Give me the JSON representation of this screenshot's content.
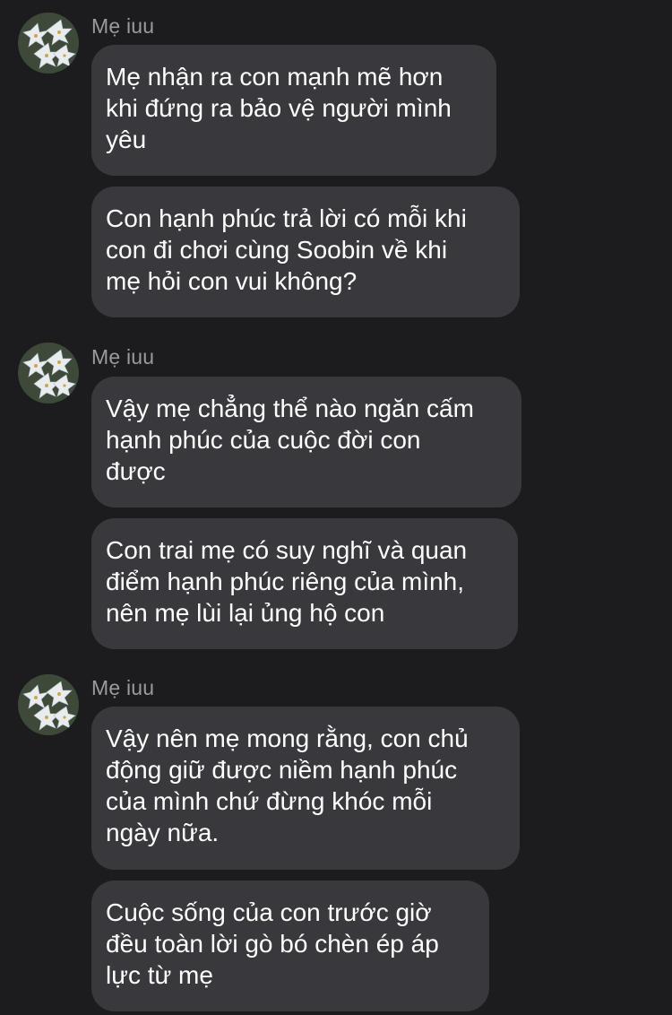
{
  "conversation": {
    "groups": [
      {
        "sender": "Mẹ iuu",
        "messages": [
          "Mẹ nhận ra con mạnh mẽ hơn\nkhi đứng ra bảo vệ người mình\nyêu",
          "Con hạnh phúc trả lời có mỗi khi\ncon đi chơi cùng Soobin về khi\nmẹ hỏi con vui không?"
        ]
      },
      {
        "sender": "Mẹ iuu",
        "messages": [
          "Vậy mẹ chẳng thể nào ngăn cấm\nhạnh phúc của cuộc đời con\nđược",
          "Con trai mẹ có suy nghĩ và quan\nđiểm hạnh phúc riêng của mình,\nnên mẹ lùi lại ủng hộ con"
        ]
      },
      {
        "sender": "Mẹ iuu",
        "messages": [
          "Vậy nên mẹ mong rằng, con chủ\nđộng giữ được niềm hạnh phúc\ncủa mình chứ đừng khóc mỗi\nngày nữa.",
          "Cuộc sống của con trước giờ\nđều toàn lời gò bó chèn ép áp\nlực từ mẹ"
        ]
      }
    ]
  },
  "colors": {
    "background": "#1c1c1e",
    "bubble": "#39393d",
    "sender_name": "#9a9a9f",
    "text": "#ffffff"
  },
  "icons": {
    "avatar": "white-lily-flowers-avatar"
  }
}
